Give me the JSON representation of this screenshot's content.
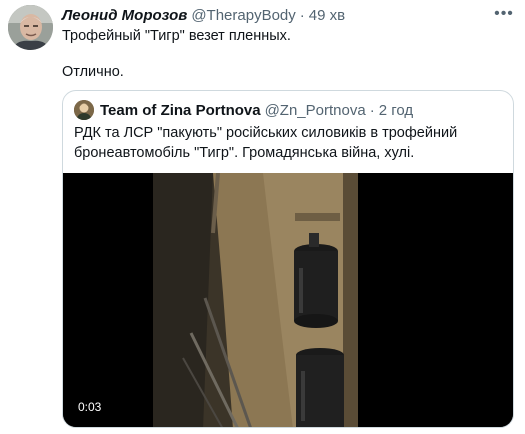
{
  "tweet": {
    "author_name": "Леонид Морозов",
    "author_handle": "@TherapyBody",
    "separator": "·",
    "time": "49 хв",
    "more_label": "•••",
    "lines": [
      "Трофейный \"Тигр\" везет пленных.",
      "Отлично."
    ]
  },
  "quote": {
    "author_name": "Team of Zina Portnova",
    "author_handle": "@Zn_Portnova",
    "separator": "·",
    "time": "2 год",
    "lines": [
      "РДК та ЛСР \"пакують\" російських силовиків в трофейний",
      "бронеавтомобіль \"Тигр\". Громадянська війна, хулі."
    ],
    "video": {
      "duration": "0:03"
    }
  }
}
